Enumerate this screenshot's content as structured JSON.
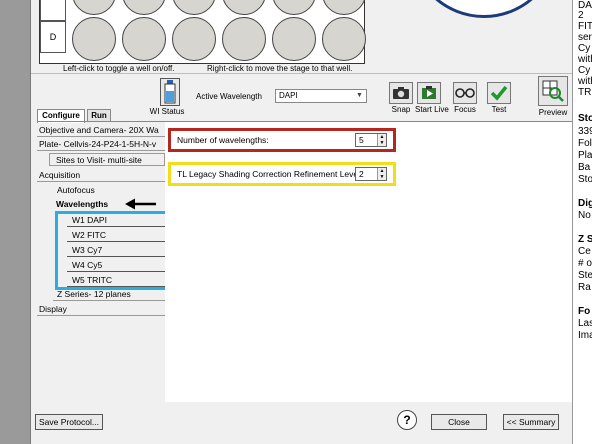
{
  "plate": {
    "row_label": "D",
    "hint_left": "Left-click to toggle a well on/off.",
    "hint_right": "Right-click to move the stage to that well."
  },
  "toolbar": {
    "wi_status_label": "WI Status",
    "active_wavelength_label": "Active Wavelength",
    "active_wavelength_value": "DAPI",
    "snap_label": "Snap",
    "start_live_label": "Start Live",
    "focus_label": "Focus",
    "test_label": "Test",
    "preview_label": "Preview"
  },
  "tabs": [
    "Configure",
    "Run"
  ],
  "tree": {
    "objective": "Objective and Camera- 20X Wa",
    "plate": "Plate- Cellvis-24-P24-1-5H-N-v",
    "sites": "Sites to Visit- multi-site",
    "acquisition": "Acquisition",
    "autofocus": "Autofocus",
    "wavelengths": "Wavelengths",
    "wavelength_items": [
      "W1 DAPI",
      "W2 FITC",
      "W3 Cy7",
      "W4 Cy5",
      "W5 TRITC"
    ],
    "z_series": "Z Series- 12 planes",
    "display": "Display"
  },
  "settings": {
    "num_wavelengths_label": "Number of wavelengths:",
    "num_wavelengths_value": "5",
    "tl_shading_label": "TL Legacy Shading Correction Refinement Level:",
    "tl_shading_value": "2"
  },
  "bottom": {
    "save_protocol": "Save Protocol...",
    "help": "?",
    "close": "Close",
    "summary": "<< Summary"
  },
  "right_window": {
    "lines": [
      "DA",
      "2",
      "FIT",
      "ser",
      "Cy",
      "with",
      "Cy",
      "with",
      "TR",
      "Sto",
      "339",
      "Fol",
      "Pla",
      "Ba",
      "Sto",
      "Dig",
      "No",
      "Z S",
      "Ce",
      "# o",
      "Ste",
      "Ra",
      "Fo",
      "Las",
      "Ima"
    ]
  },
  "colors": {
    "highlight_red": "#b5261e",
    "highlight_yellow": "#f2dd1a",
    "highlight_blue": "#29aee0",
    "stage_circle": "#1d3a7a"
  }
}
